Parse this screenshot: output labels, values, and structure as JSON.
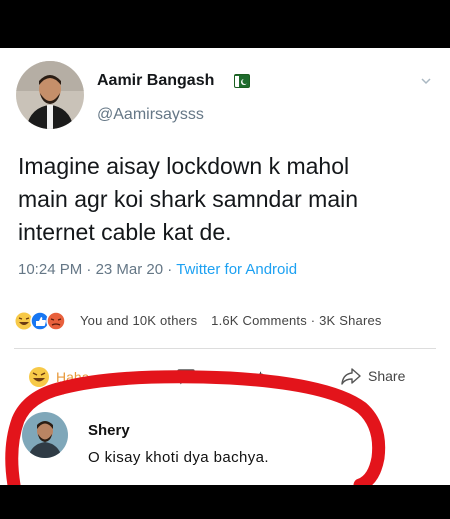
{
  "author": {
    "name": "Aamir Bangash",
    "handle": "@Aamirsaysss",
    "badge_icon": "pakistan-flag-icon"
  },
  "tweet": {
    "lines": [
      "Imagine aisay lockdown k mahol",
      "main agr koi shark samndar main",
      "internet cable kat de."
    ],
    "time": "10:24 PM",
    "date": "23 Mar 20",
    "source": "Twitter for Android"
  },
  "post": {
    "reactions_text": "You and 10K others",
    "counts_text": "1.6K Comments · 3K Shares",
    "actions": {
      "haha": "Haha",
      "comment": "Comment",
      "share": "Share"
    }
  },
  "comment": {
    "author": "Shery",
    "text": "O kisay khoti dya bachya."
  },
  "colors": {
    "link": "#1da1f2",
    "annotation": "#e3141b",
    "muted": "#657786"
  }
}
